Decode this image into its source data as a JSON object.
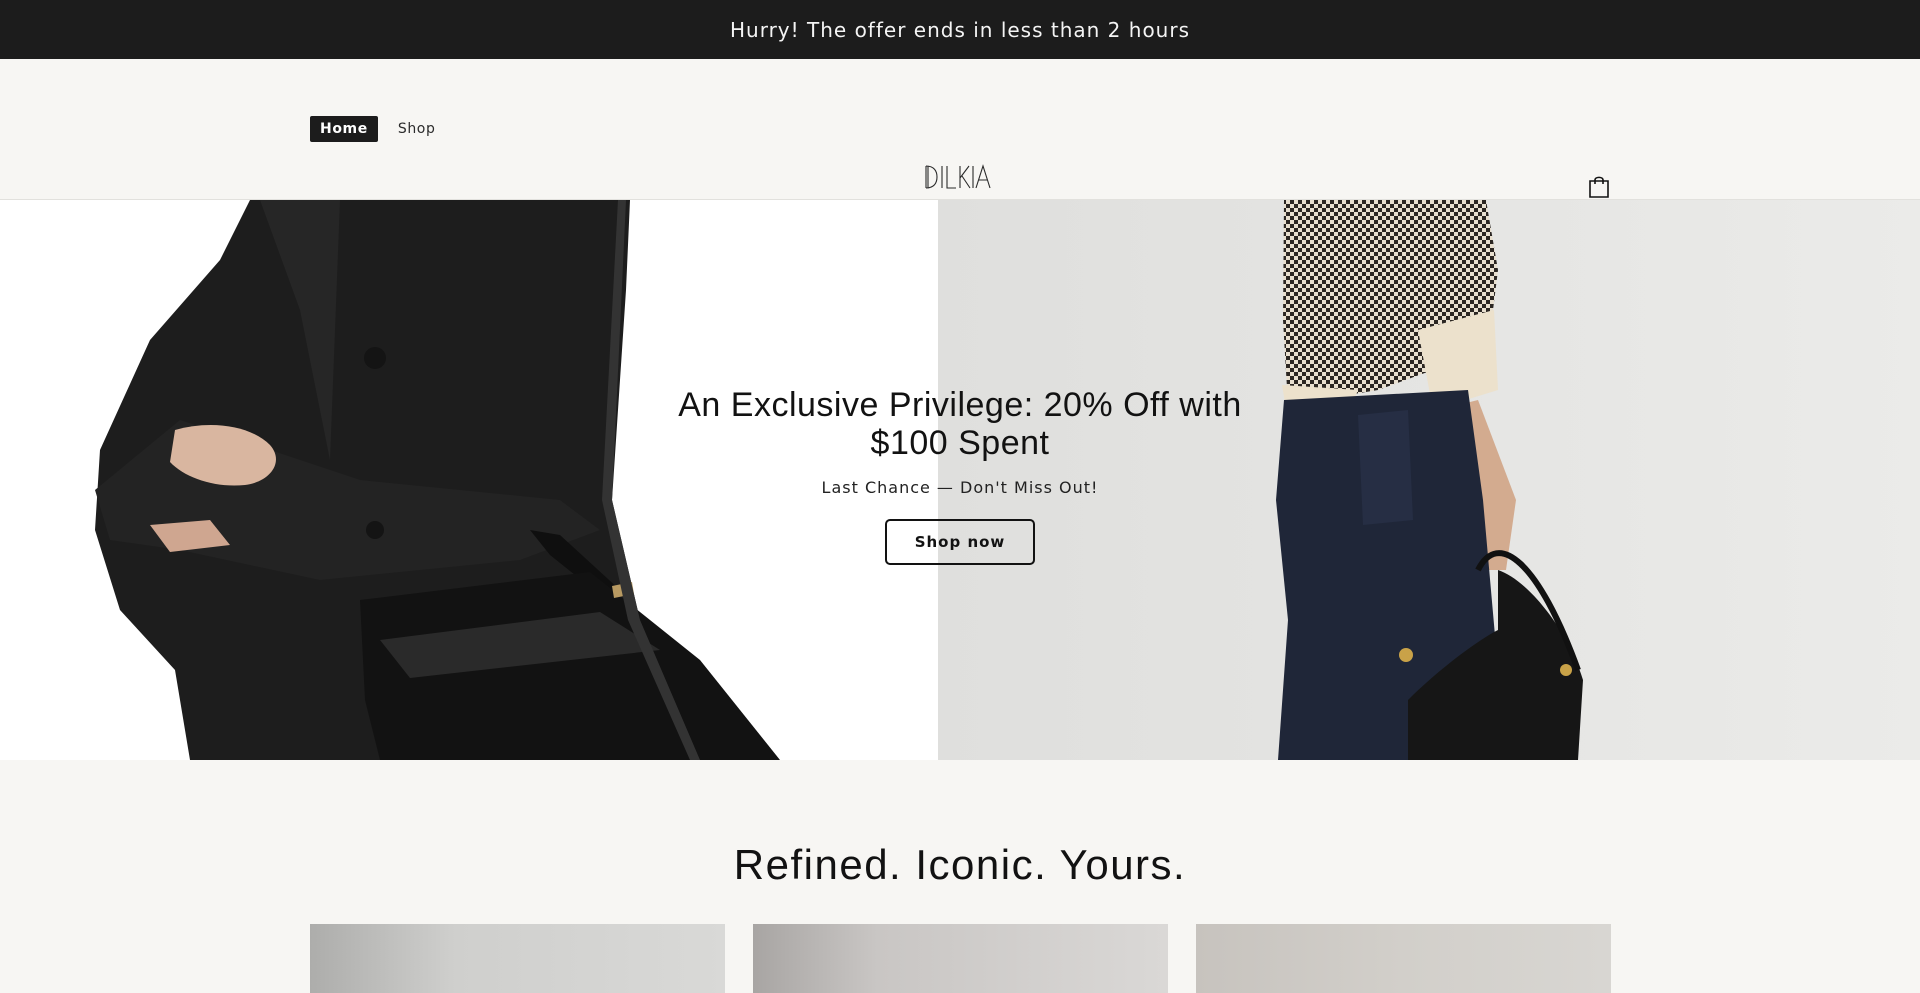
{
  "announcement": {
    "text": "Hurry! The offer ends in less than 2 hours"
  },
  "header": {
    "nav": [
      {
        "label": "Home",
        "active": true
      },
      {
        "label": "Shop",
        "active": false
      }
    ],
    "logo": "DILKIA",
    "cart_icon": "shopping-bag-icon"
  },
  "hero": {
    "title": "An Exclusive Privilege: 20% Off with $100 Spent",
    "subtitle": "Last Chance — Don't Miss Out!",
    "button_label": "Shop now"
  },
  "collection": {
    "title": "Refined. Iconic. Yours."
  },
  "colors": {
    "announcement_bg": "#1c1c1c",
    "page_bg": "#f7f6f3",
    "accent": "#121212"
  }
}
